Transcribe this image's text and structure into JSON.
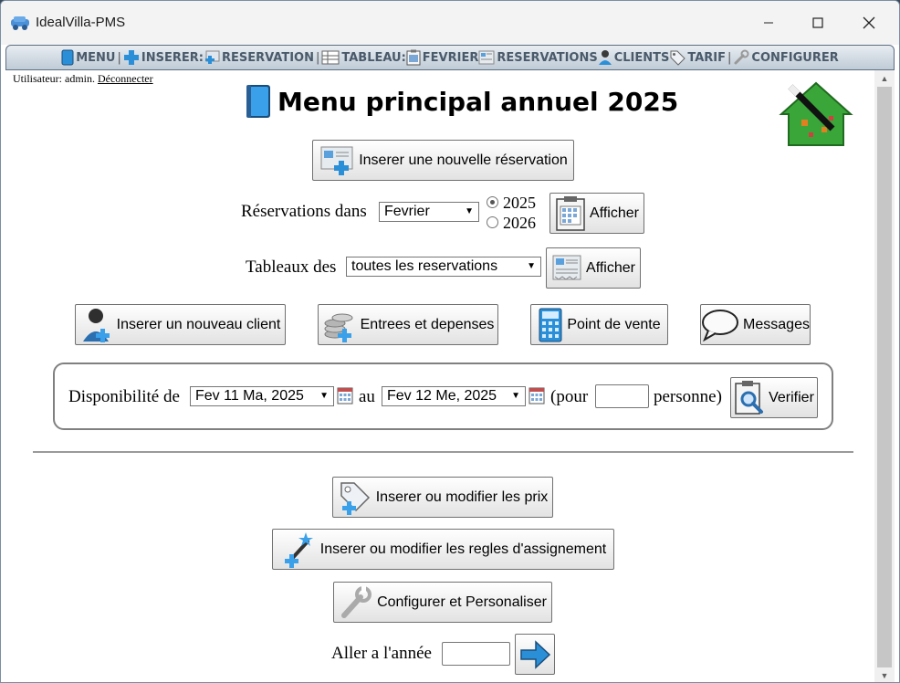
{
  "window": {
    "title": "IdealVilla-PMS"
  },
  "menu": {
    "items": [
      {
        "label": "MENU",
        "icon": "book-icon"
      },
      {
        "label": "INSERER:",
        "icon": "plus-icon"
      },
      {
        "label": "RESERVATION",
        "icon": "reservation-icon"
      },
      {
        "label": "TABLEAU:",
        "icon": "table-icon"
      },
      {
        "label": "FEVRIER",
        "icon": "clipboard-icon"
      },
      {
        "label": "RESERVATIONS",
        "icon": "reservations-icon"
      },
      {
        "label": "CLIENTS",
        "icon": "client-icon"
      },
      {
        "label": "TARIF",
        "icon": "tag-icon"
      },
      {
        "label": "CONFIGURER",
        "icon": "wrench-icon"
      }
    ]
  },
  "user": {
    "prefix": "Utilisateur: admin.",
    "logout": "Déconnecter"
  },
  "heading": "Menu principal annuel 2025",
  "buttons": {
    "new_reservation": "Inserer une nouvelle réservation",
    "show1": "Afficher",
    "show2": "Afficher",
    "new_client": "Inserer un nouveau client",
    "income": "Entrees et depenses",
    "pos": "Point de vente",
    "messages": "Messages",
    "verify": "Verifier",
    "prices": "Inserer ou modifier les prix",
    "rules": "Inserer ou modifier les regles d'assignement",
    "configure": "Configurer et Personaliser"
  },
  "reservations_row": {
    "label": "Réservations dans",
    "month": "Fevrier",
    "year_a": "2025",
    "year_b": "2026",
    "selected_year": "2025"
  },
  "tables_row": {
    "label": "Tableaux des",
    "selection": "toutes les reservations"
  },
  "availability": {
    "label": "Disponibilité de",
    "from": "Fev 11 Ma, 2025",
    "to_label": "au",
    "to": "Fev 12 Me, 2025",
    "pour": "(pour",
    "persons": "",
    "persons_suffix": "personne)"
  },
  "go_year": {
    "label": "Aller a l'année",
    "value": ""
  },
  "colors": {
    "accent_blue": "#2b8fd8",
    "logo_green": "#3aa63a",
    "menubar": "#bfcbd6"
  }
}
